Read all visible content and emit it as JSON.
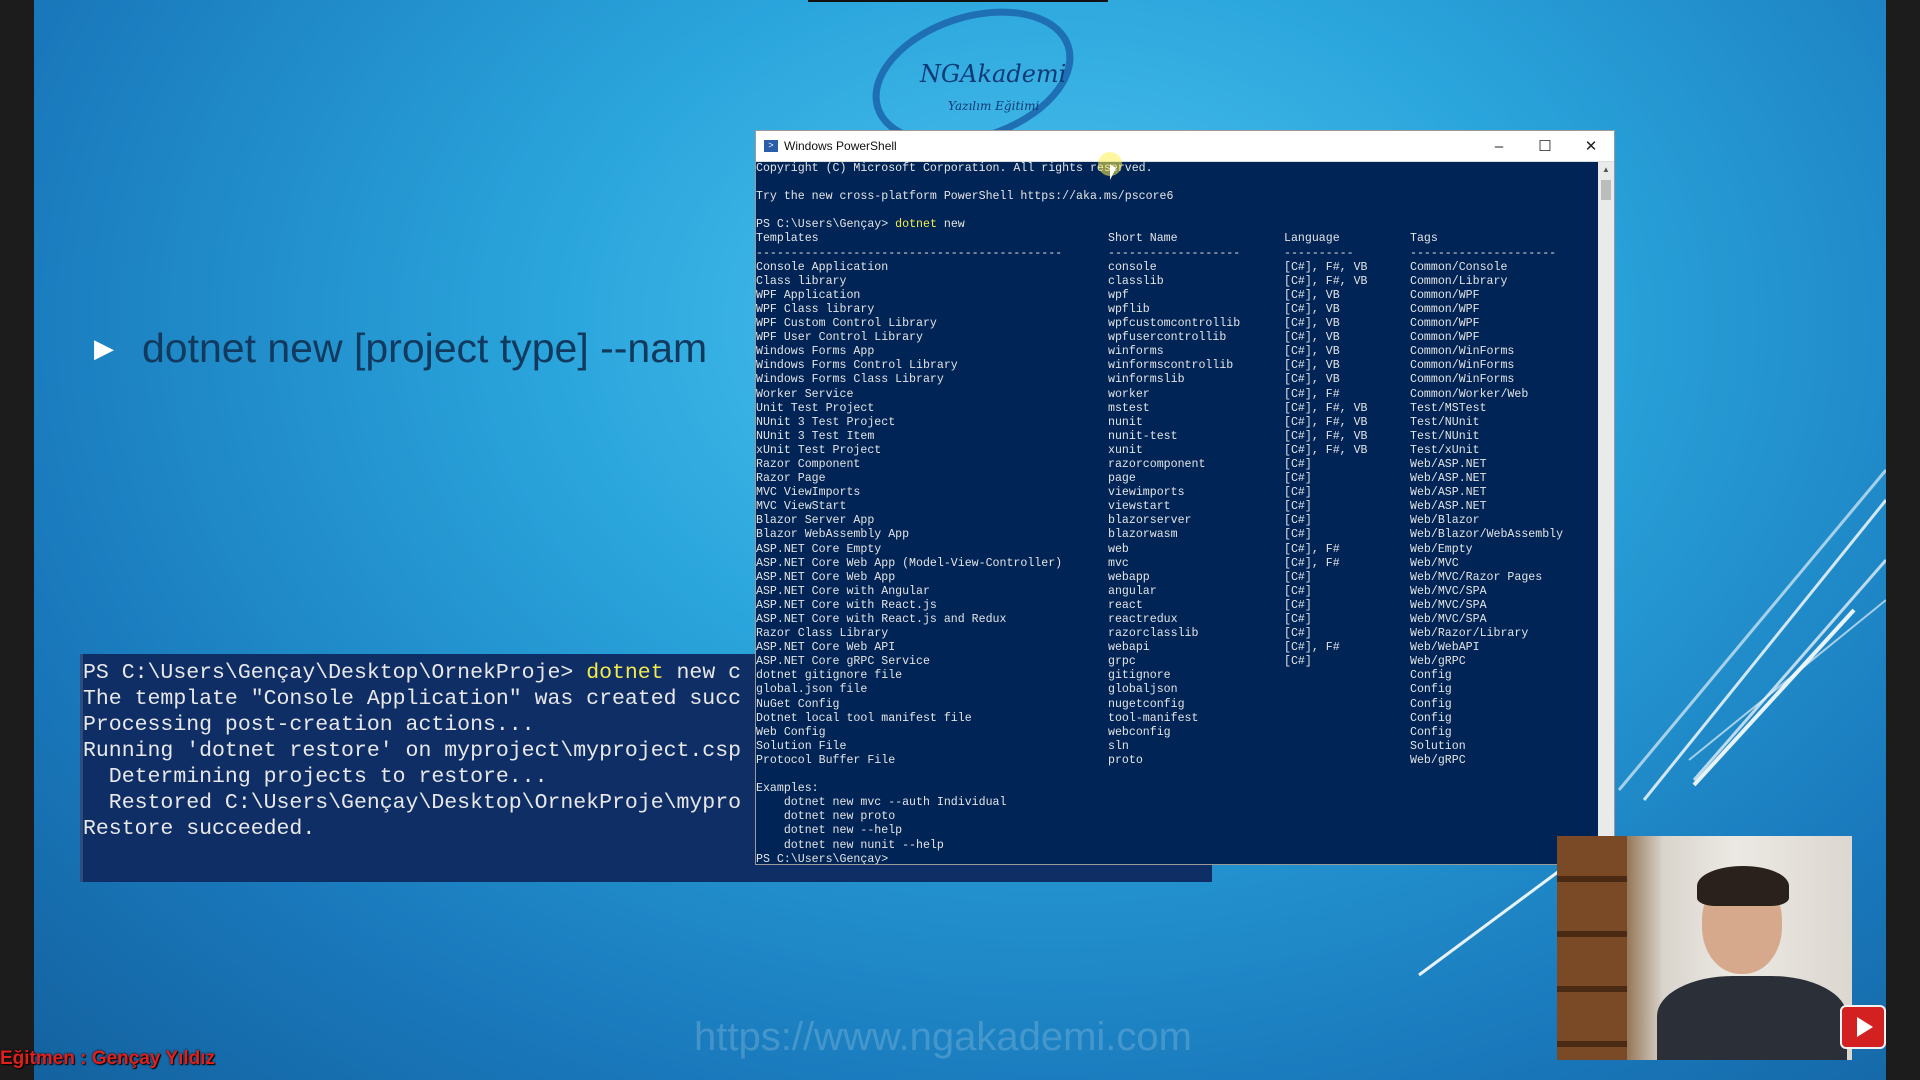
{
  "slide": {
    "bullet_text": "dotnet new [project type] --nam",
    "watermark_url": "https://www.ngakademi.com",
    "instructor": "Eğitmen : Gençay Yıldız",
    "logo_title": "NGAkademi",
    "logo_subtitle": "Yazılım Eğitimi"
  },
  "slide_terminal": {
    "lines": [
      {
        "prefix": "PS C:\\Users\\Gençay\\Desktop\\OrnekProje> ",
        "cmd": "dotnet",
        "rest": " new c"
      },
      {
        "prefix": "The template \"Console Application\" was created succ",
        "cmd": "",
        "rest": ""
      },
      {
        "prefix": "",
        "cmd": "",
        "rest": ""
      },
      {
        "prefix": "Processing post-creation actions...",
        "cmd": "",
        "rest": ""
      },
      {
        "prefix": "Running 'dotnet restore' on myproject\\myproject.csp",
        "cmd": "",
        "rest": ""
      },
      {
        "prefix": "  Determining projects to restore...",
        "cmd": "",
        "rest": ""
      },
      {
        "prefix": "  Restored C:\\Users\\Gençay\\Desktop\\OrnekProje\\mypro",
        "cmd": "",
        "rest": ""
      },
      {
        "prefix": "Restore succeeded.",
        "cmd": "",
        "rest": ""
      }
    ]
  },
  "ps": {
    "title": "Windows PowerShell",
    "copyright": "Copyright (C) Microsoft Corporation. All rights reserved.",
    "tryline": "Try the new cross-platform PowerShell https://aka.ms/pscore6",
    "prompt": "PS C:\\Users\\Gençay> ",
    "command_name": "dotnet",
    "command_rest": " new",
    "headers": [
      "Templates",
      "Short Name",
      "Language",
      "Tags"
    ],
    "separators": [
      "--------------------------------------------",
      "-------------------",
      "----------",
      "---------------------"
    ],
    "rows": [
      [
        "Console Application",
        "console",
        "[C#], F#, VB",
        "Common/Console"
      ],
      [
        "Class library",
        "classlib",
        "[C#], F#, VB",
        "Common/Library"
      ],
      [
        "WPF Application",
        "wpf",
        "[C#], VB",
        "Common/WPF"
      ],
      [
        "WPF Class library",
        "wpflib",
        "[C#], VB",
        "Common/WPF"
      ],
      [
        "WPF Custom Control Library",
        "wpfcustomcontrollib",
        "[C#], VB",
        "Common/WPF"
      ],
      [
        "WPF User Control Library",
        "wpfusercontrollib",
        "[C#], VB",
        "Common/WPF"
      ],
      [
        "Windows Forms App",
        "winforms",
        "[C#], VB",
        "Common/WinForms"
      ],
      [
        "Windows Forms Control Library",
        "winformscontrollib",
        "[C#], VB",
        "Common/WinForms"
      ],
      [
        "Windows Forms Class Library",
        "winformslib",
        "[C#], VB",
        "Common/WinForms"
      ],
      [
        "Worker Service",
        "worker",
        "[C#], F#",
        "Common/Worker/Web"
      ],
      [
        "Unit Test Project",
        "mstest",
        "[C#], F#, VB",
        "Test/MSTest"
      ],
      [
        "NUnit 3 Test Project",
        "nunit",
        "[C#], F#, VB",
        "Test/NUnit"
      ],
      [
        "NUnit 3 Test Item",
        "nunit-test",
        "[C#], F#, VB",
        "Test/NUnit"
      ],
      [
        "xUnit Test Project",
        "xunit",
        "[C#], F#, VB",
        "Test/xUnit"
      ],
      [
        "Razor Component",
        "razorcomponent",
        "[C#]",
        "Web/ASP.NET"
      ],
      [
        "Razor Page",
        "page",
        "[C#]",
        "Web/ASP.NET"
      ],
      [
        "MVC ViewImports",
        "viewimports",
        "[C#]",
        "Web/ASP.NET"
      ],
      [
        "MVC ViewStart",
        "viewstart",
        "[C#]",
        "Web/ASP.NET"
      ],
      [
        "Blazor Server App",
        "blazorserver",
        "[C#]",
        "Web/Blazor"
      ],
      [
        "Blazor WebAssembly App",
        "blazorwasm",
        "[C#]",
        "Web/Blazor/WebAssembly"
      ],
      [
        "ASP.NET Core Empty",
        "web",
        "[C#], F#",
        "Web/Empty"
      ],
      [
        "ASP.NET Core Web App (Model-View-Controller)",
        "mvc",
        "[C#], F#",
        "Web/MVC"
      ],
      [
        "ASP.NET Core Web App",
        "webapp",
        "[C#]",
        "Web/MVC/Razor Pages"
      ],
      [
        "ASP.NET Core with Angular",
        "angular",
        "[C#]",
        "Web/MVC/SPA"
      ],
      [
        "ASP.NET Core with React.js",
        "react",
        "[C#]",
        "Web/MVC/SPA"
      ],
      [
        "ASP.NET Core with React.js and Redux",
        "reactredux",
        "[C#]",
        "Web/MVC/SPA"
      ],
      [
        "Razor Class Library",
        "razorclasslib",
        "[C#]",
        "Web/Razor/Library"
      ],
      [
        "ASP.NET Core Web API",
        "webapi",
        "[C#], F#",
        "Web/WebAPI"
      ],
      [
        "ASP.NET Core gRPC Service",
        "grpc",
        "[C#]",
        "Web/gRPC"
      ],
      [
        "dotnet gitignore file",
        "gitignore",
        "",
        "Config"
      ],
      [
        "global.json file",
        "globaljson",
        "",
        "Config"
      ],
      [
        "NuGet Config",
        "nugetconfig",
        "",
        "Config"
      ],
      [
        "Dotnet local tool manifest file",
        "tool-manifest",
        "",
        "Config"
      ],
      [
        "Web Config",
        "webconfig",
        "",
        "Config"
      ],
      [
        "Solution File",
        "sln",
        "",
        "Solution"
      ],
      [
        "Protocol Buffer File",
        "proto",
        "",
        "Web/gRPC"
      ]
    ],
    "examples_label": "Examples:",
    "examples": [
      "    dotnet new mvc --auth Individual",
      "    dotnet new proto",
      "    dotnet new --help",
      "    dotnet new nunit --help"
    ],
    "final_prompt": "PS C:\\Users\\Gençay>"
  }
}
